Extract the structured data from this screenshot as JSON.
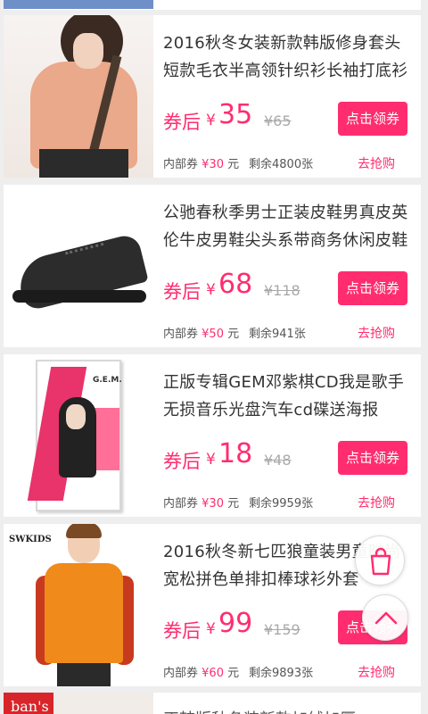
{
  "products": [
    {
      "title": "2016秋冬女装新款韩版修身套头短款毛衣半高领针织衫长袖打底衫",
      "after_label": "券后",
      "currency": "¥",
      "price": "35",
      "original_price": "¥65",
      "claim_button": "点击领券",
      "coupon_label": "内部券",
      "coupon_value": "¥30",
      "coupon_unit": "元",
      "remaining": "剩余4800张",
      "go_link": "去抢购",
      "image": "woman-sweater-photo"
    },
    {
      "title": "公驰春秋季男士正装皮鞋男真皮英伦牛皮男鞋尖头系带商务休闲皮鞋",
      "after_label": "券后",
      "currency": "¥",
      "price": "68",
      "original_price": "¥118",
      "claim_button": "点击领券",
      "coupon_label": "内部券",
      "coupon_value": "¥50",
      "coupon_unit": "元",
      "remaining": "剩余941张",
      "go_link": "去抢购",
      "image": "leather-shoe-photo"
    },
    {
      "title": "正版专辑GEM邓紫棋CD我是歌手无损音乐光盘汽车cd碟送海报",
      "after_label": "券后",
      "currency": "¥",
      "price": "18",
      "original_price": "¥48",
      "claim_button": "点击领券",
      "coupon_label": "内部券",
      "coupon_value": "¥30",
      "coupon_unit": "元",
      "remaining": "剩余9959张",
      "go_link": "去抢购",
      "image": "cd-album-photo",
      "image_text": "G.E.M."
    },
    {
      "title": "2016秋冬新七匹狼童装男童时尚宽松拼色单排扣棒球衫外套",
      "after_label": "券后",
      "currency": "¥",
      "price": "99",
      "original_price": "¥159",
      "claim_button": "点击领券",
      "coupon_label": "内部券",
      "coupon_value": "¥60",
      "coupon_unit": "元",
      "remaining": "剩余9893张",
      "go_link": "去抢购",
      "image": "kid-jacket-photo",
      "image_text": "SWKIDS"
    }
  ],
  "peek_item": {
    "brand_text": "ban's",
    "title": "正韩版秋冬装新款加绒加厚"
  },
  "floating": {
    "bag_icon": "shopping-bag-icon",
    "top_icon": "chevron-up-icon"
  },
  "colors": {
    "accent": "#ff2d6f",
    "background": "#eeeeee",
    "card": "#ffffff"
  }
}
